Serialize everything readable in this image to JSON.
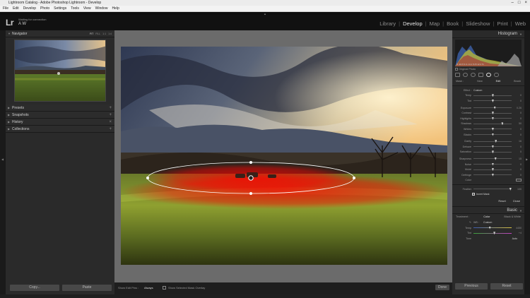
{
  "window": {
    "title": "Lightroom Catalog - Adobe Photoshop Lightroom - Develop",
    "controls": [
      "–",
      "□",
      "×"
    ]
  },
  "menu": [
    "File",
    "Edit",
    "Develop",
    "Photo",
    "Settings",
    "Tools",
    "View",
    "Window",
    "Help"
  ],
  "identity": {
    "logo": "Lr",
    "status": "Waiting for connection",
    "name": "A W"
  },
  "modules": [
    {
      "label": "Library",
      "active": false
    },
    {
      "label": "Develop",
      "active": true
    },
    {
      "label": "Map",
      "active": false
    },
    {
      "label": "Book",
      "active": false
    },
    {
      "label": "Slideshow",
      "active": false
    },
    {
      "label": "Print",
      "active": false
    },
    {
      "label": "Web",
      "active": false
    }
  ],
  "left_panel": {
    "navigator": {
      "label": "Navigator",
      "zoom_options": [
        "FIT",
        "FILL",
        "1:1",
        "1:4"
      ]
    },
    "sections": [
      "Presets",
      "Snapshots",
      "History",
      "Collections"
    ],
    "copy_button": "Copy...",
    "paste_button": "Paste"
  },
  "toolbar": {
    "show_edit_pins_label": "Show Edit Pins :",
    "show_edit_pins_value": "Always",
    "overlay_label": "Show Selected Mask Overlay",
    "done_button": "Done"
  },
  "right_panel": {
    "histogram": {
      "label": "Histogram",
      "readout": "R  44.8  %   G  14.1  %   B  12.2  %",
      "original_photo": "Original Photo"
    },
    "mask": {
      "label": "Mask :",
      "new": "New",
      "edit": "Edit",
      "brush": "Brush"
    },
    "effect": {
      "label": "Effect :",
      "value": "Custom"
    },
    "sliders": [
      {
        "label": "Temp",
        "value": "0",
        "pos": 0.5
      },
      {
        "label": "Tint",
        "value": "0",
        "pos": 0.5
      },
      {
        "label": "Exposure",
        "value": "0.26",
        "pos": 0.55
      },
      {
        "label": "Contrast",
        "value": "0",
        "pos": 0.5
      },
      {
        "label": "Highlights",
        "value": "0",
        "pos": 0.5
      },
      {
        "label": "Shadows",
        "value": "50",
        "pos": 0.75
      },
      {
        "label": "Whites",
        "value": "0",
        "pos": 0.5
      },
      {
        "label": "Blacks",
        "value": "0",
        "pos": 0.5
      },
      {
        "label": "Clarity",
        "value": "16",
        "pos": 0.58
      },
      {
        "label": "Dehaze",
        "value": "0",
        "pos": 0.5
      },
      {
        "label": "Saturation",
        "value": "0",
        "pos": 0.5
      },
      {
        "label": "Sharpness",
        "value": "15",
        "pos": 0.57
      },
      {
        "label": "Noise",
        "value": "0",
        "pos": 0.5
      },
      {
        "label": "Moiré",
        "value": "0",
        "pos": 0.5
      },
      {
        "label": "Defringe",
        "value": "0",
        "pos": 0.5
      }
    ],
    "color_label": "Color",
    "feather": {
      "label": "Feather",
      "value": "100"
    },
    "invert_mask": "Invert Mask",
    "reset_button": "Reset",
    "close_button": "Close",
    "basic": {
      "label": "Basic",
      "treatment_label": "Treatment :",
      "color": "Color",
      "bw": "Black & White",
      "wb_label": "WB :",
      "wb_value": "Custom",
      "temp_label": "Temp",
      "temp_value": "4450",
      "tint_label": "Tint",
      "tint_value": "+4",
      "tone_label": "Tone",
      "auto": "Auto"
    },
    "previous_button": "Previous",
    "reset_main_button": "Reset"
  }
}
